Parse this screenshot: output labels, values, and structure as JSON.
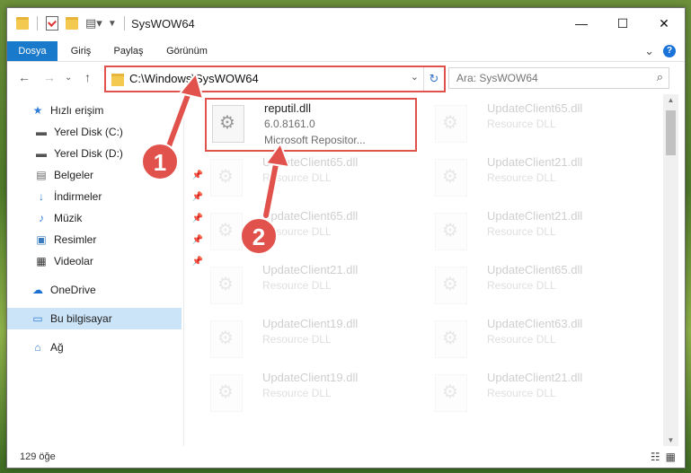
{
  "titlebar": {
    "title": "SysWOW64",
    "minimize": "—",
    "maximize": "☐",
    "close": "✕"
  },
  "ribbon": {
    "tabs": [
      "Dosya",
      "Giriş",
      "Paylaş",
      "Görünüm"
    ],
    "expand": "⌄",
    "help": "?"
  },
  "nav": {
    "back": "←",
    "forward": "→",
    "recent": "⌄",
    "up": "↑",
    "address": "C:\\Windows\\SysWOW64",
    "address_dropdown": "⌄",
    "refresh": "↻",
    "search_placeholder": "Ara: SysWOW64",
    "search_icon": "⌕"
  },
  "sidebar": {
    "items": [
      {
        "label": "Hızlı erişim",
        "icon": "star-icon",
        "glyph": "★"
      },
      {
        "label": "Yerel Disk (C:)",
        "icon": "drive-icon",
        "glyph": "▬"
      },
      {
        "label": "Yerel Disk (D:)",
        "icon": "drive-icon",
        "glyph": "▬"
      },
      {
        "label": "Belgeler",
        "icon": "documents-icon",
        "glyph": "▤"
      },
      {
        "label": "İndirmeler",
        "icon": "download-icon",
        "glyph": "↓"
      },
      {
        "label": "Müzik",
        "icon": "music-icon",
        "glyph": "♪"
      },
      {
        "label": "Resimler",
        "icon": "pictures-icon",
        "glyph": "▣"
      },
      {
        "label": "Videolar",
        "icon": "video-icon",
        "glyph": "▦"
      },
      {
        "label": "OneDrive",
        "icon": "cloud-icon",
        "glyph": "☁"
      },
      {
        "label": "Bu bilgisayar",
        "icon": "computer-icon",
        "glyph": "▭"
      },
      {
        "label": "Ağ",
        "icon": "network-icon",
        "glyph": "⌂"
      }
    ],
    "pin": "📌"
  },
  "files": [
    {
      "name": "reputil.dll",
      "line2": "6.0.8161.0",
      "line3": "Microsoft Repositor..."
    },
    {
      "name": "UpdateClient65.dll",
      "line2": "Resource DLL"
    },
    {
      "name": "UpdateClient65.dll",
      "line2": "Resource DLL"
    },
    {
      "name": "UpdateClient21.dll",
      "line2": "Resource DLL"
    },
    {
      "name": "UpdateClient65.dll",
      "line2": "Resource DLL"
    },
    {
      "name": "UpdateClient21.dll",
      "line2": "Resource DLL"
    },
    {
      "name": "UpdateClient21.dll",
      "line2": "Resource DLL"
    },
    {
      "name": "UpdateClient65.dll",
      "line2": "Resource DLL"
    },
    {
      "name": "UpdateClient19.dll",
      "line2": "Resource DLL"
    },
    {
      "name": "UpdateClient63.dll",
      "line2": "Resource DLL"
    },
    {
      "name": "UpdateClient19.dll",
      "line2": "Resource DLL"
    },
    {
      "name": "UpdateClient21.dll",
      "line2": "Resource DLL"
    }
  ],
  "status": {
    "count": "129 öğe",
    "details_view": "☷",
    "tiles_view": "▦"
  },
  "annotations": {
    "step1": "1",
    "step2": "2",
    "color": "#e0524b"
  }
}
